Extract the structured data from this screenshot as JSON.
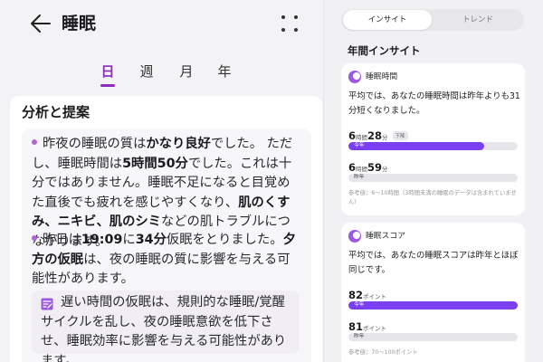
{
  "header": {
    "title": "睡眠",
    "back_icon": "arrow-left-icon",
    "more_icon": "grid-dots-icon"
  },
  "period_tabs": [
    {
      "label": "日",
      "active": true
    },
    {
      "label": "週",
      "active": false
    },
    {
      "label": "月",
      "active": false
    },
    {
      "label": "年",
      "active": false
    }
  ],
  "analysis": {
    "section_title": "分析と提案",
    "para1_segments": [
      {
        "text": "昨夜の睡眠の質は",
        "bold": false
      },
      {
        "text": "かなり良好",
        "bold": true
      },
      {
        "text": "でした。 ただし、睡眠時間は",
        "bold": false
      },
      {
        "text": "5時間50分",
        "bold": true
      },
      {
        "text": "でした。これは十分ではありません。睡眠不足になると目覚めた直後でも疲れを感じやすくなり、",
        "bold": false
      },
      {
        "text": "肌のくすみ、ニキビ、肌のシミ",
        "bold": true
      },
      {
        "text": "などの肌トラブルにつながります。",
        "bold": false
      }
    ],
    "para2_segments": [
      {
        "text": "昨日は",
        "bold": false
      },
      {
        "text": "19:09",
        "bold": true
      },
      {
        "text": "に",
        "bold": false
      },
      {
        "text": "34分",
        "bold": true
      },
      {
        "text": "仮眠をとりました。",
        "bold": false
      },
      {
        "text": "夕方の仮眠",
        "bold": true
      },
      {
        "text": "は、夜の睡眠の質に影響を与える可能性があります。",
        "bold": false
      }
    ],
    "note": {
      "icon": "note-edit-icon",
      "text": "遅い時間の仮眠は、規則的な睡眠/覚醒サイクルを乱し、夜の睡眠意欲を低下させ、睡眠効率に影響を与える可能性があります。"
    }
  },
  "insights": {
    "segments": [
      {
        "label": "インサイト",
        "active": true
      },
      {
        "label": "トレンド",
        "active": false
      }
    ],
    "section_title": "年間インサイト",
    "cards": [
      {
        "title": "睡眠時間",
        "icon": "moon-icon",
        "description": "平均では、あなたの睡眠時間は昨年よりも31分短くなりました。",
        "this_year": {
          "value_parts": [
            {
              "n": "6",
              "u": "時間"
            },
            {
              "n": "28",
              "u": "分"
            }
          ],
          "tag": "下降",
          "bar_label": "今年",
          "fill": 0.8
        },
        "last_year": {
          "value_parts": [
            {
              "n": "6",
              "u": "時間"
            },
            {
              "n": "59",
              "u": "分"
            }
          ],
          "bar_label": "昨年",
          "fill": 1.0
        },
        "reference": "参考値：6～10時間（3時間未満の睡眠のデータは含まれていません）"
      },
      {
        "title": "睡眠スコア",
        "icon": "moon-icon",
        "description": "平均では、あなたの睡眠スコアは昨年とほぼ同じです。",
        "this_year": {
          "value_parts": [
            {
              "n": "82",
              "u": "ポイント"
            }
          ],
          "bar_label": "今年",
          "fill": 1.0
        },
        "last_year": {
          "value_parts": [
            {
              "n": "81",
              "u": "ポイント"
            }
          ],
          "bar_label": "昨年",
          "fill": 1.0
        },
        "reference": "参考値：70～100ポイント"
      }
    ]
  },
  "colors": {
    "accent": "#8f2bbd",
    "bar_fill": "#7b3ff2",
    "bar_track": "#e6e6ea"
  }
}
